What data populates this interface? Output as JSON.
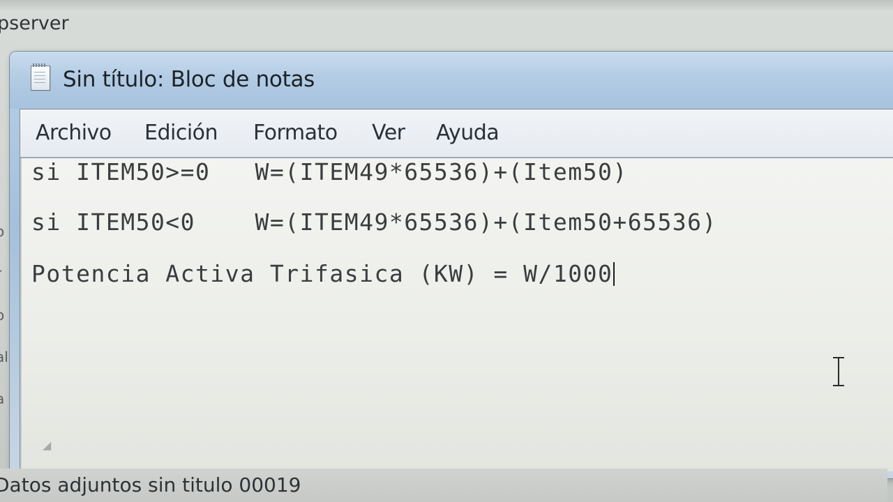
{
  "background_window": {
    "title_fragment": "pserver",
    "status_text": "Datos adjuntos sin titulo 00019",
    "left_edge_glyphs": [
      "o",
      "r",
      "o",
      "al",
      "a"
    ]
  },
  "notepad": {
    "title": "Sin título: Bloc de notas",
    "menu": [
      "Archivo",
      "Edición",
      "Formato",
      "Ver",
      "Ayuda"
    ],
    "lines": [
      "si ITEM50>=0   W=(ITEM49*65536)+(Item50)",
      "si ITEM50<0    W=(ITEM49*65536)+(Item50+65536)",
      "Potencia Activa Trifasica (KW) = W/1000"
    ]
  },
  "icons": {
    "app": "notepad-icon",
    "cursor": "text-ibeam-cursor-icon"
  }
}
